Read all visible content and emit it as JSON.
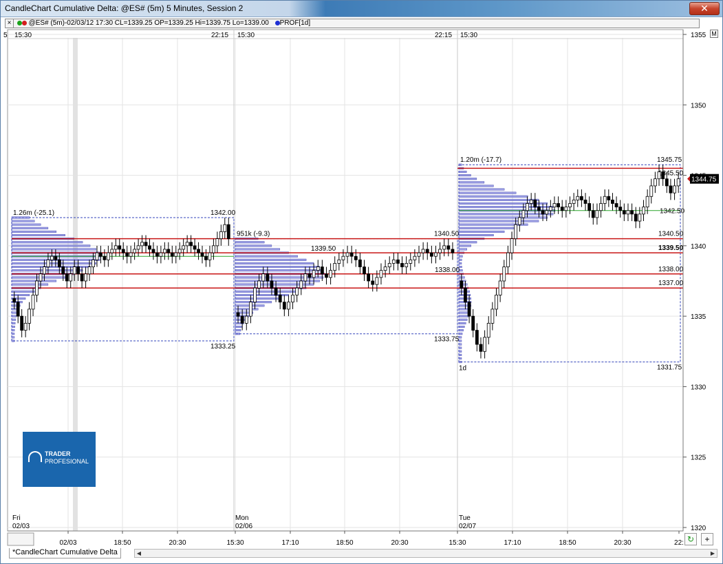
{
  "window": {
    "title": "CandleChart Cumulative Delta: @ES# (5m) 5 Minutes, Session 2",
    "close_label": "✕"
  },
  "infobar": {
    "text": "@ES# (5m)-02/03/12 17:30 CL=1339.25 OP=1339.25 Hi=1339.75 Lo=1339.00",
    "study": "PROF[1d]",
    "colors": {
      "green": "#1aa31a",
      "red": "#d41e1e",
      "blue": "#1e2fd4"
    }
  },
  "time_header": {
    "labels": [
      "15:30",
      "22:15",
      "15:30",
      "22:15",
      "15:30"
    ],
    "left_edge": "5"
  },
  "price_axis": {
    "ticks": [
      "1355",
      "1350",
      "1345",
      "1340",
      "1335",
      "1330",
      "1325",
      "1320"
    ],
    "current_price": "1344.75",
    "m_button": "M"
  },
  "time_axis": {
    "ticks": [
      "02/03",
      "18:50",
      "20:30",
      "15:30",
      "17:10",
      "18:50",
      "20:30",
      "15:30",
      "17:10",
      "18:50",
      "20:30",
      "22:"
    ],
    "days": [
      {
        "weekday": "Fri",
        "date": "02/03"
      },
      {
        "weekday": "Mon",
        "date": "02/06"
      },
      {
        "weekday": "Tue",
        "date": "02/07"
      }
    ]
  },
  "sessions": [
    {
      "volume_label": "1.26m (-25.1)",
      "high_label": "1342.00",
      "low_label": "1333.25",
      "high": 1342.0,
      "low": 1333.25,
      "poc": 1339.25
    },
    {
      "volume_label": "951k (-9.3)",
      "high_label": "1340.50",
      "low_label": "1333.75",
      "high": 1340.5,
      "low": 1333.75,
      "poc": 1338.0,
      "extra_label": "1339.50",
      "extra_label_2": "1338.00"
    },
    {
      "volume_label": "1.20m (-17.7)",
      "high_label": "1345.75",
      "low_label": "1331.75",
      "high": 1345.75,
      "low": 1331.75,
      "poc": 1342.5,
      "period_label": "1d"
    }
  ],
  "levels": [
    {
      "price": 1345.5,
      "label": ""
    },
    {
      "price": 1340.5,
      "label": "1340.50"
    },
    {
      "price": 1339.5,
      "label": "1339.50"
    },
    {
      "price": 1338.0,
      "label": "1338.00"
    },
    {
      "price": 1337.0,
      "label": "1337.00"
    }
  ],
  "right_labels": {
    "last_high": "1345.50",
    "poc3": "1342.50"
  },
  "logo": {
    "line1": "TRADER",
    "line2": "PROFESIONAL"
  },
  "bottom": {
    "tab_label": "*CandleChart Cumulative Delta",
    "refresh": "↻",
    "plus": "+",
    "scroll_left": "◀",
    "scroll_right": "▶"
  },
  "chart_data": {
    "type": "candlestick",
    "ylim": [
      1320,
      1356
    ],
    "sessions": [
      {
        "day": "02/03",
        "closes": [
          1336,
          1335,
          1334,
          1334.5,
          1335.5,
          1336.5,
          1337.5,
          1338,
          1338.5,
          1339,
          1339.25,
          1339,
          1338.5,
          1338,
          1337.5,
          1338,
          1338.5,
          1338,
          1337.5,
          1338,
          1338.5,
          1339,
          1339.5,
          1339.25,
          1339,
          1339.5,
          1339.75,
          1340,
          1339.75,
          1339.5,
          1339.25,
          1339.5,
          1339.75,
          1340,
          1340.25,
          1340,
          1339.75,
          1339.5,
          1339.25,
          1339.5,
          1339.75,
          1339.5,
          1339.25,
          1339.5,
          1339.75,
          1340,
          1340.25,
          1340,
          1339.75,
          1339.5,
          1339.25,
          1339,
          1339.5,
          1340,
          1340.5,
          1341,
          1341.5,
          1340.5
        ]
      },
      {
        "day": "02/06",
        "closes": [
          1335,
          1334.5,
          1335,
          1336,
          1337,
          1337.5,
          1338,
          1337.5,
          1337,
          1336.5,
          1336,
          1335.5,
          1336,
          1336.5,
          1337,
          1337.5,
          1338,
          1337.75,
          1338.25,
          1338.5,
          1338,
          1337.75,
          1338.25,
          1338.75,
          1339,
          1339.25,
          1339.5,
          1339.25,
          1339,
          1338.5,
          1338,
          1337.5,
          1337.25,
          1337.75,
          1338.25,
          1338.5,
          1338.75,
          1339,
          1338.75,
          1338.5,
          1338.75,
          1339,
          1339.25,
          1339.5,
          1339.75,
          1339.5,
          1339.25,
          1339.5,
          1339.75,
          1340,
          1339.75,
          1339.5
        ]
      },
      {
        "day": "02/07",
        "closes": [
          1337,
          1336,
          1335,
          1334,
          1333,
          1332.5,
          1333.5,
          1334.5,
          1335.5,
          1336.5,
          1337.5,
          1338.5,
          1339.5,
          1340.5,
          1341.5,
          1342,
          1342.5,
          1343,
          1343.25,
          1342.75,
          1342.5,
          1342.25,
          1342.5,
          1342.75,
          1343,
          1342.75,
          1342.5,
          1342.75,
          1343,
          1343.25,
          1343.5,
          1343.25,
          1343,
          1342.5,
          1342,
          1342.5,
          1343,
          1343.5,
          1343.25,
          1343,
          1342.75,
          1342.5,
          1342.25,
          1342.5,
          1342.25,
          1341.75,
          1342.25,
          1342.75,
          1343.5,
          1344.25,
          1344.75,
          1345.25,
          1344.75,
          1344.25,
          1343.75,
          1344.25,
          1344.75
        ]
      }
    ]
  }
}
